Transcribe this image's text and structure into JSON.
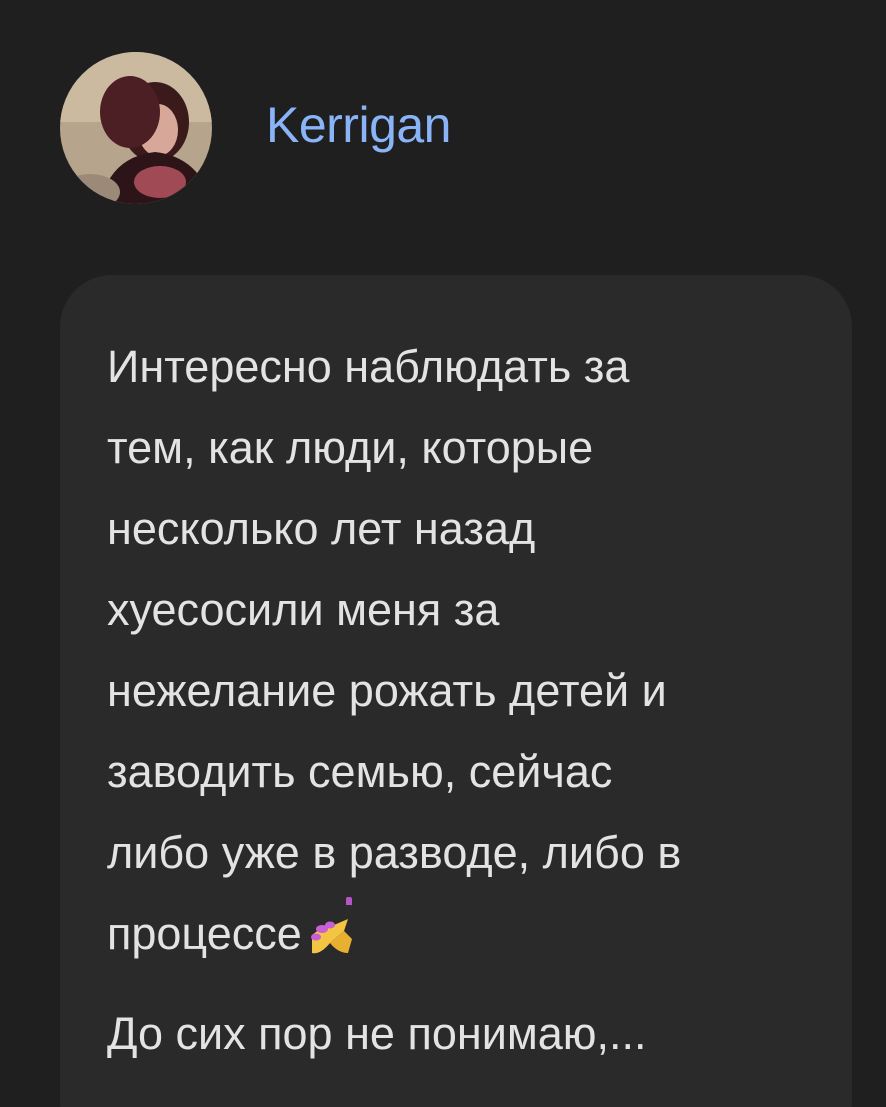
{
  "author": {
    "name": "Kerrigan",
    "avatar_icon": "user-avatar-photo"
  },
  "post": {
    "lines": [
      "Интересно наблюдать за",
      "тем, как люди, которые",
      "несколько лет назад",
      "хуесосили меня за",
      "нежелание рожать детей и",
      "заводить семью, сейчас",
      "либо уже в разводе, либо в",
      "процессе"
    ],
    "emoji": "nail-polish-emoji",
    "truncated_line": "До сих пор не понимаю,..."
  },
  "colors": {
    "background": "#1f1f1f",
    "bubble": "#2a2a2a",
    "username": "#8ab4f8",
    "text": "#e3e3e3"
  }
}
